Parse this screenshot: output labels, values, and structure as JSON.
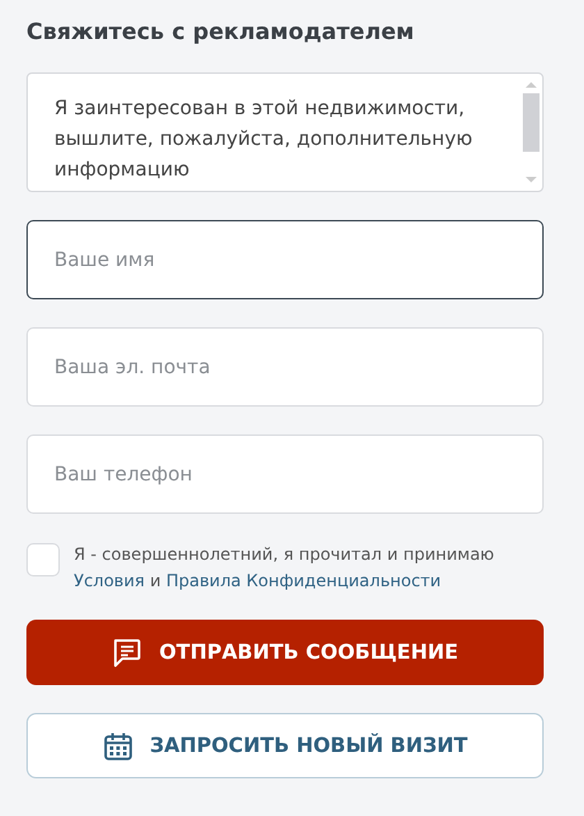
{
  "title": "Свяжитесь с рекламодателем",
  "message": {
    "value": "Я заинтересован в этой недвижимости, вышлите, пожалуйста, дополнительную информацию"
  },
  "fields": [
    {
      "placeholder": "Ваше имя",
      "focused": true
    },
    {
      "placeholder": "Ваша эл. почта",
      "focused": false
    },
    {
      "placeholder": "Ваш телефон",
      "focused": false
    }
  ],
  "consent": {
    "checked": false,
    "parts": [
      {
        "kind": "text",
        "text": "Я - совершеннолетний, я прочитал и принимаю "
      },
      {
        "kind": "link",
        "text": "Условия"
      },
      {
        "kind": "text",
        "text": " и "
      },
      {
        "kind": "link",
        "text": "Правила Конфиденциальности"
      }
    ]
  },
  "buttons": [
    {
      "kind": "primary",
      "label": "ОТПРАВИТЬ СООБЩЕНИЕ"
    },
    {
      "kind": "secondary",
      "label": "ЗАПРОСИТЬ НОВЫЙ ВИЗИТ"
    }
  ]
}
